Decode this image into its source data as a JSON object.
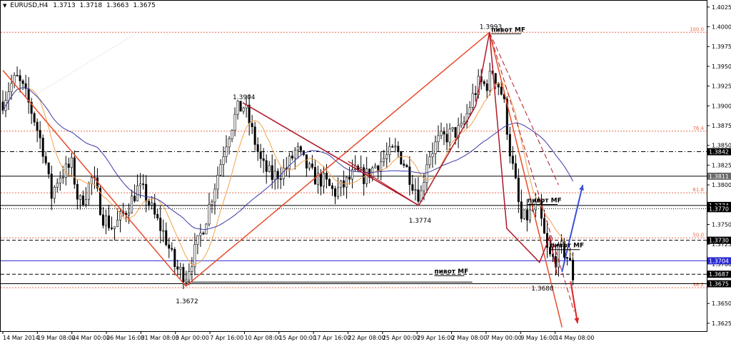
{
  "header": {
    "symbol": "EURUSD,H4",
    "quotes": [
      "1.3713",
      "1.3718",
      "1.3663",
      "1.3675"
    ]
  },
  "colors": {
    "price_line": "#000000",
    "fast_ma": "#f5a04a",
    "slow_ma": "#3a3aa8",
    "pattern_main": "#e84b2a",
    "pattern_inner": "#b01828",
    "fib_level": "#e86a4a",
    "arrow_up": "#3a4ed8",
    "arrow_down": "#e02020",
    "hline_black": "#000000",
    "hline_blue": "#2a2ad0"
  },
  "chart_data": {
    "type": "candlestick",
    "symbol": "EURUSD",
    "timeframe": "H4",
    "ylim": [
      1.3615,
      1.4033
    ],
    "y_ticks": [
      "1.4025",
      "1.4000",
      "1.3975",
      "1.3950",
      "1.3925",
      "1.3900",
      "1.3875",
      "1.3850",
      "1.3825",
      "1.3800",
      "1.3775",
      "1.3750",
      "1.3725",
      "1.3700",
      "1.3675",
      "1.3650",
      "1.3625"
    ],
    "x_ticks": [
      {
        "label": "14 Mar 2014",
        "t": 0
      },
      {
        "label": "19 Mar 08:00",
        "t": 1
      },
      {
        "label": "24 Mar 00:00",
        "t": 2
      },
      {
        "label": "26 Mar 16:00",
        "t": 3
      },
      {
        "label": "31 Mar 08:00",
        "t": 4
      },
      {
        "label": "3 Apr 00:00",
        "t": 5
      },
      {
        "label": "7 Apr 16:00",
        "t": 6
      },
      {
        "label": "10 Apr 08:00",
        "t": 7
      },
      {
        "label": "15 Apr 00:00",
        "t": 8
      },
      {
        "label": "17 Apr 16:00",
        "t": 9
      },
      {
        "label": "22 Apr 08:00",
        "t": 10
      },
      {
        "label": "25 Apr 00:00",
        "t": 11
      },
      {
        "label": "29 Apr 16:00",
        "t": 12
      },
      {
        "label": "2 May 08:00",
        "t": 13
      },
      {
        "label": "7 May 00:00",
        "t": 14
      },
      {
        "label": "9 May 16:00",
        "t": 15
      },
      {
        "label": "14 May 08:00",
        "t": 16
      }
    ],
    "price_anchors": [
      [
        0,
        1.3905
      ],
      [
        0.2,
        1.3925
      ],
      [
        0.4,
        1.3935
      ],
      [
        0.6,
        1.392
      ],
      [
        0.9,
        1.3885
      ],
      [
        1.2,
        1.384
      ],
      [
        1.4,
        1.3785
      ],
      [
        1.6,
        1.381
      ],
      [
        2.0,
        1.3825
      ],
      [
        2.2,
        1.3775
      ],
      [
        2.4,
        1.379
      ],
      [
        2.6,
        1.381
      ],
      [
        2.9,
        1.376
      ],
      [
        3.2,
        1.3745
      ],
      [
        3.6,
        1.377
      ],
      [
        3.9,
        1.3795
      ],
      [
        4.1,
        1.379
      ],
      [
        4.4,
        1.376
      ],
      [
        4.7,
        1.3735
      ],
      [
        5.0,
        1.3695
      ],
      [
        5.3,
        1.3685
      ],
      [
        5.6,
        1.372
      ],
      [
        5.9,
        1.376
      ],
      [
        6.2,
        1.381
      ],
      [
        6.5,
        1.386
      ],
      [
        6.8,
        1.3895
      ],
      [
        7.0,
        1.39
      ],
      [
        7.2,
        1.387
      ],
      [
        7.5,
        1.3825
      ],
      [
        7.8,
        1.381
      ],
      [
        8.0,
        1.3815
      ],
      [
        8.2,
        1.382
      ],
      [
        8.5,
        1.3845
      ],
      [
        8.7,
        1.383
      ],
      [
        9.0,
        1.381
      ],
      [
        9.3,
        1.3805
      ],
      [
        9.6,
        1.379
      ],
      [
        9.9,
        1.38
      ],
      [
        10.2,
        1.3815
      ],
      [
        10.5,
        1.381
      ],
      [
        10.8,
        1.3825
      ],
      [
        11.1,
        1.3835
      ],
      [
        11.4,
        1.3845
      ],
      [
        11.6,
        1.383
      ],
      [
        11.9,
        1.38
      ],
      [
        12.1,
        1.3785
      ],
      [
        12.3,
        1.3835
      ],
      [
        12.6,
        1.3855
      ],
      [
        13.0,
        1.3865
      ],
      [
        13.3,
        1.387
      ],
      [
        13.6,
        1.391
      ],
      [
        13.8,
        1.393
      ],
      [
        14.0,
        1.3925
      ],
      [
        14.2,
        1.3945
      ],
      [
        14.5,
        1.391
      ],
      [
        14.7,
        1.384
      ],
      [
        14.9,
        1.379
      ],
      [
        15.0,
        1.3755
      ],
      [
        15.2,
        1.376
      ],
      [
        15.5,
        1.3775
      ],
      [
        15.8,
        1.371
      ],
      [
        16.0,
        1.3705
      ],
      [
        16.2,
        1.372
      ],
      [
        16.4,
        1.3705
      ],
      [
        16.55,
        1.3678
      ]
    ],
    "horizontal_lines": [
      {
        "price": 1.3842,
        "label": "1.3842",
        "style": "dashdot",
        "color": "#000000",
        "label_bg": "#000000"
      },
      {
        "price": 1.3811,
        "label": "1.3811",
        "style": "solid",
        "color": "#000000",
        "label_bg": "#6b6b6b"
      },
      {
        "price": 1.3774,
        "label": "1.3774",
        "style": "solid",
        "color": "#000000",
        "label_bg": "#000000"
      },
      {
        "price": 1.377,
        "label": "1.3770",
        "style": "dotted",
        "color": "#000000",
        "label_bg": "#000000"
      },
      {
        "price": 1.373,
        "label": "1.3730",
        "style": "dashed",
        "color": "#000000",
        "label_bg": "#000000"
      },
      {
        "price": 1.3704,
        "label": "1.3704",
        "style": "solid",
        "color": "#2a2ad0",
        "label_bg": "#2a2ad0"
      },
      {
        "price": 1.3687,
        "label": "1.3687",
        "style": "dashed",
        "color": "#000000",
        "label_bg": "#000000"
      },
      {
        "price": 1.3675,
        "label": "1.3675",
        "style": "solid",
        "color": "#000000",
        "label_bg": "#000000"
      }
    ],
    "fib_levels": [
      {
        "label": "100.0",
        "price": 1.3993
      },
      {
        "label": "76.4",
        "price": 1.3868
      },
      {
        "label": "61.8",
        "price": 1.379
      },
      {
        "label": "50.0",
        "price": 1.3733
      },
      {
        "label": "38.2",
        "price": 1.367
      }
    ],
    "points": [
      {
        "label": "1.3993",
        "t": 14.1,
        "price": 1.3993
      },
      {
        "label": "1.3904",
        "t": 6.95,
        "price": 1.3904
      },
      {
        "label": "1.3774",
        "t": 12.05,
        "price": 1.3774
      },
      {
        "label": "1.3672",
        "t": 5.3,
        "price": 1.3672
      },
      {
        "label": "1.3688",
        "t": 15.6,
        "price": 1.3688
      }
    ],
    "pattern_main": [
      [
        0,
        1.3945
      ],
      [
        5.3,
        1.3672
      ],
      [
        14.1,
        1.3993
      ],
      [
        16.2,
        1.362
      ]
    ],
    "pattern_inner": [
      [
        6.95,
        1.3904
      ],
      [
        12.05,
        1.3774
      ],
      [
        13.7,
        1.39
      ],
      [
        14.1,
        1.3993
      ],
      [
        14.6,
        1.3745
      ],
      [
        15.55,
        1.3702
      ],
      [
        15.85,
        1.3735
      ],
      [
        16.05,
        1.3688
      ]
    ],
    "pattern_inner2": [
      [
        6.95,
        1.3904
      ],
      [
        12.05,
        1.3774
      ],
      [
        10.0,
        1.383
      ]
    ],
    "dashed_lines": [
      [
        [
          14.1,
          1.3993
        ],
        [
          16.55,
          1.364
        ]
      ],
      [
        [
          14.1,
          1.3993
        ],
        [
          16.1,
          1.38
        ]
      ]
    ],
    "dotted_line": [
      [
        0.8,
        1.391
      ],
      [
        3.8,
        1.399
      ]
    ],
    "pivot_labels": [
      {
        "text": "пивот MF",
        "t": 14.15,
        "price": 1.3993
      },
      {
        "text": "пивот MF",
        "t": 15.2,
        "price": 1.3777
      },
      {
        "text": "пивот MF",
        "t": 15.85,
        "price": 1.372
      },
      {
        "text": "пивот MF",
        "t": 12.5,
        "price": 1.3687
      }
    ],
    "support_line": [
      [
        5.3,
        1.3677
      ],
      [
        13.6,
        1.3677
      ]
    ],
    "arrow_up": [
      [
        16.2,
        1.369
      ],
      [
        16.8,
        1.38
      ]
    ],
    "arrow_down": [
      [
        16.45,
        1.3678
      ],
      [
        16.65,
        1.3625
      ]
    ]
  }
}
